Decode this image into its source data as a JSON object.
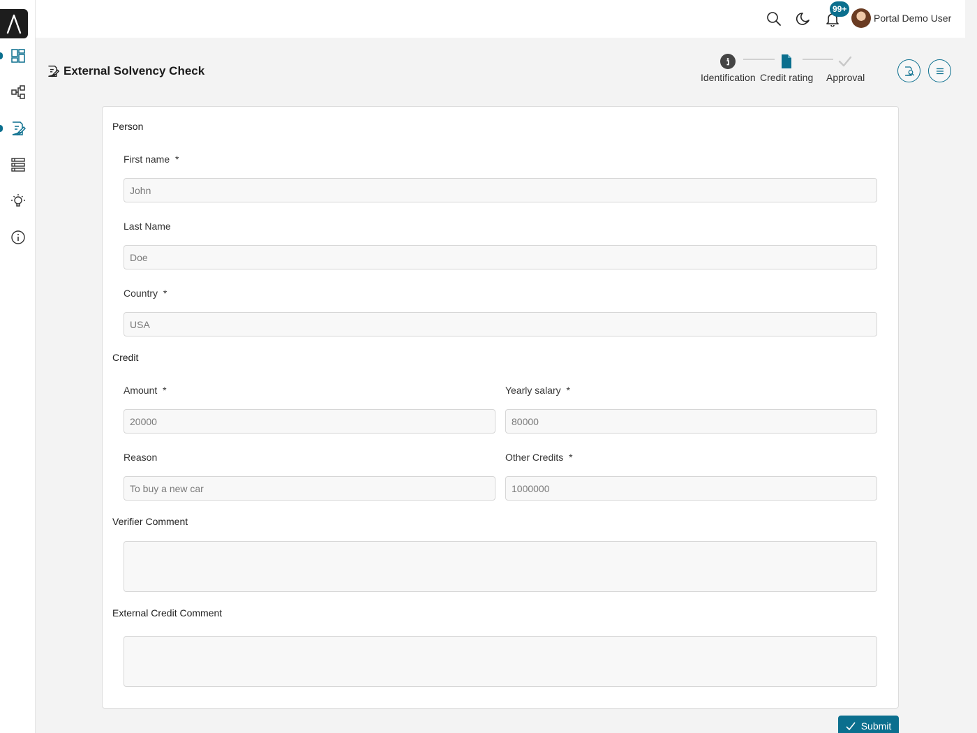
{
  "topbar": {
    "notification_count": "99+",
    "user_name": "Portal Demo User"
  },
  "sidebar": {
    "items": [
      {
        "name": "dashboard-icon",
        "active": true
      },
      {
        "name": "process-icon",
        "active": false
      },
      {
        "name": "task-icon",
        "active": true
      },
      {
        "name": "list-icon",
        "active": false
      },
      {
        "name": "lightbulb-icon",
        "active": false
      },
      {
        "name": "info-icon",
        "active": false
      }
    ]
  },
  "page": {
    "title": "External Solvency Check"
  },
  "stepper": {
    "steps": [
      {
        "label": "Identification",
        "state": "done",
        "icon": "info-icon"
      },
      {
        "label": "Credit rating",
        "state": "current",
        "icon": "document-icon"
      },
      {
        "label": "Approval",
        "state": "pending",
        "icon": "check-icon"
      }
    ]
  },
  "form": {
    "person": {
      "title": "Person",
      "first_name": {
        "label": "First name",
        "required": "*",
        "placeholder": "John"
      },
      "last_name": {
        "label": "Last Name",
        "placeholder": "Doe"
      },
      "country": {
        "label": "Country",
        "required": "*",
        "placeholder": "USA"
      }
    },
    "credit": {
      "title": "Credit",
      "amount": {
        "label": "Amount",
        "required": "*",
        "placeholder": "20000"
      },
      "yearly_salary": {
        "label": "Yearly salary",
        "required": "*",
        "placeholder": "80000"
      },
      "reason": {
        "label": "Reason",
        "placeholder": "To buy a new car"
      },
      "other_credits": {
        "label": "Other Credits",
        "required": "*",
        "placeholder": "1000000"
      }
    },
    "verifier_comment": {
      "title": "Verifier Comment"
    },
    "external_credit_comment": {
      "title": "External Credit Comment"
    },
    "submit_label": "Submit"
  },
  "colors": {
    "accent": "#0b6f8e",
    "background": "#f3f3f3"
  }
}
